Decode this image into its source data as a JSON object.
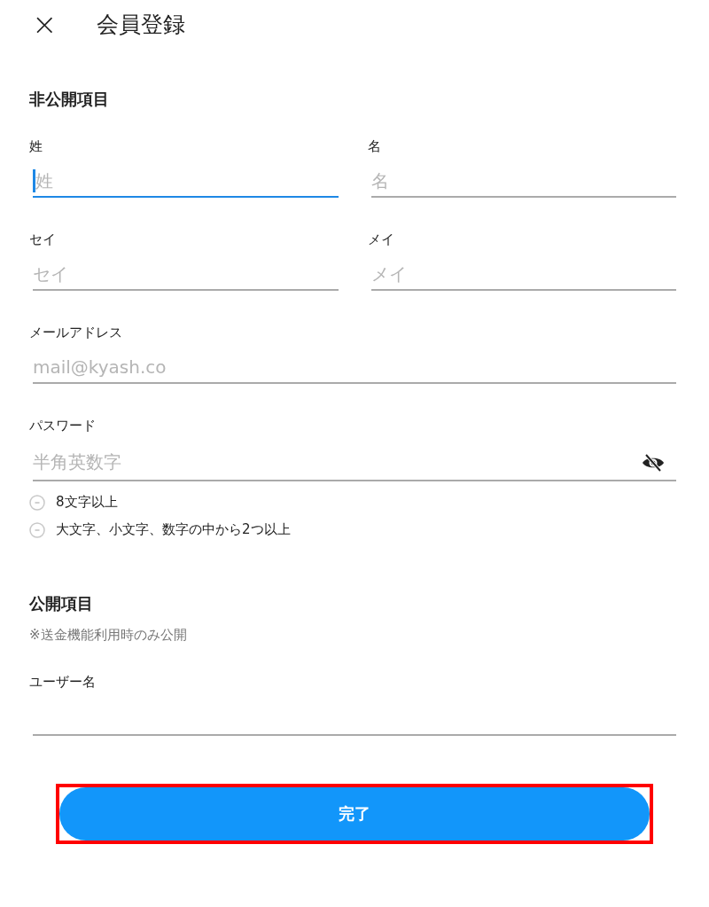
{
  "header": {
    "close_icon": "×",
    "title": "会員登録"
  },
  "private_section": {
    "title": "非公開項目",
    "rows": [
      [
        {
          "kind": "text",
          "label": "姓",
          "placeholder": "姓",
          "focused": true
        },
        {
          "kind": "text",
          "label": "名",
          "placeholder": "名",
          "focused": false
        }
      ],
      [
        {
          "kind": "text",
          "label": "セイ",
          "placeholder": "セイ",
          "focused": false
        },
        {
          "kind": "text",
          "label": "メイ",
          "placeholder": "メイ",
          "focused": false
        }
      ],
      [
        {
          "kind": "text",
          "label": "メールアドレス",
          "placeholder": "mail@kyash.co",
          "focused": false
        }
      ],
      [
        {
          "kind": "password",
          "label": "パスワード",
          "placeholder": "半角英数字",
          "focused": false
        }
      ]
    ],
    "password_rules": [
      {
        "text": "8文字以上",
        "met": false
      },
      {
        "text": "大文字、小文字、数字の中から2つ以上",
        "met": false
      }
    ]
  },
  "public_section": {
    "title": "公開項目",
    "note": "※送金機能利用時のみ公開",
    "rows": [
      [
        {
          "label": "ユーザー名",
          "focused": false
        }
      ]
    ]
  },
  "submit_button": {
    "label": "完了",
    "highlighted": true
  }
}
